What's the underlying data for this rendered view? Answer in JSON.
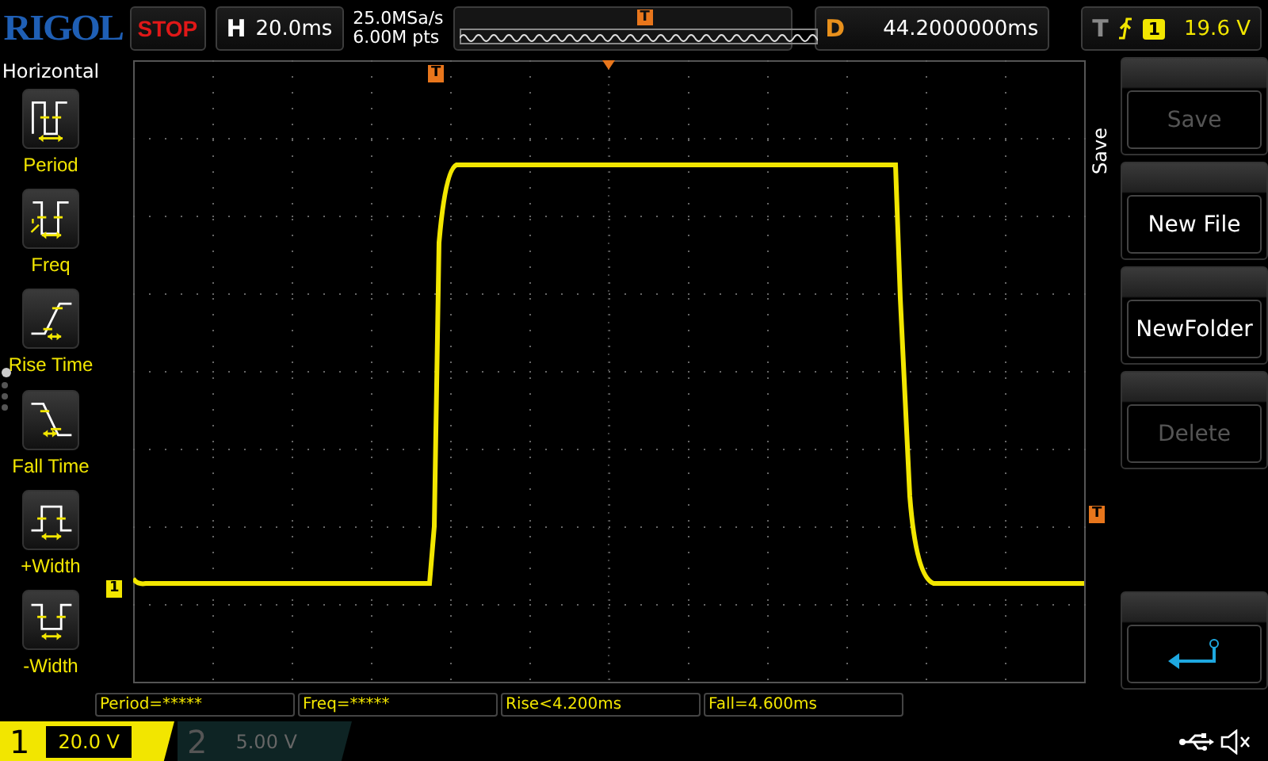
{
  "logo": "RIGOL",
  "run_state": "STOP",
  "timebase": {
    "label": "H",
    "value": "20.0ms"
  },
  "sample": {
    "rate": "25.0MSa/s",
    "depth": "6.00M pts"
  },
  "memory_marker": "T",
  "delay": {
    "label": "D",
    "value": "44.2000000ms"
  },
  "trigger": {
    "label": "T",
    "channel": "1",
    "level": "19.6 V"
  },
  "left_menu": {
    "title": "Horizontal",
    "pages": [
      {
        "selected": true
      },
      {
        "selected": false
      },
      {
        "selected": false
      },
      {
        "selected": false
      }
    ],
    "items": [
      {
        "label": "Period",
        "kind": "period"
      },
      {
        "label": "Freq",
        "kind": "freq"
      },
      {
        "label": "Rise Time",
        "kind": "rise"
      },
      {
        "label": "Fall Time",
        "kind": "fall"
      },
      {
        "label": "+Width",
        "kind": "pwidth"
      },
      {
        "label": "-Width",
        "kind": "nwidth"
      }
    ]
  },
  "screen": {
    "time_marker": "T",
    "channel_marker": "1",
    "trigger_level_marker": "T"
  },
  "right_menu": {
    "title": "Save",
    "items": [
      {
        "kind": "text",
        "label": "Save",
        "disabled": true
      },
      {
        "kind": "text",
        "label": "New File",
        "disabled": false
      },
      {
        "kind": "text",
        "label": "NewFolder",
        "disabled": false
      },
      {
        "kind": "text",
        "label": "Delete",
        "disabled": true
      },
      {
        "kind": "back",
        "disabled": false
      }
    ]
  },
  "measurements": [
    "Period=*****",
    "Freq=*****",
    "Rise<4.200ms",
    "Fall=4.600ms"
  ],
  "channels": [
    {
      "number": "1",
      "scale": "20.0 V",
      "selected": true
    },
    {
      "number": "2",
      "scale": "5.00 V",
      "selected": false
    }
  ]
}
